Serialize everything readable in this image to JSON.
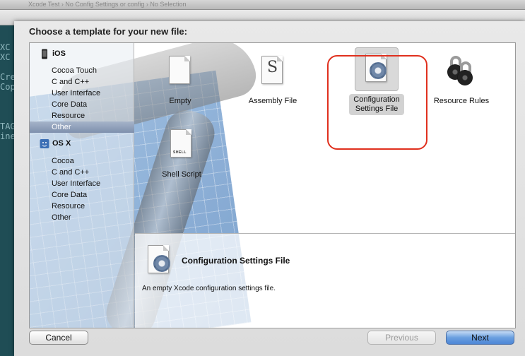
{
  "background": {
    "breadcrumb": "Xcode Test  ›  No Config Settings or config  ›  No Selection",
    "code_lines": [
      "XC",
      "XC",
      "",
      "Cre",
      "Cop",
      "",
      "",
      "",
      "TAG",
      "ine"
    ]
  },
  "dialog": {
    "title": "Choose a template for your new file:",
    "sidebar": {
      "groups": [
        {
          "label": "iOS",
          "items": [
            "Cocoa Touch",
            "C and C++",
            "User Interface",
            "Core Data",
            "Resource",
            "Other"
          ],
          "selected": "Other"
        },
        {
          "label": "OS X",
          "items": [
            "Cocoa",
            "C and C++",
            "User Interface",
            "Core Data",
            "Resource",
            "Other"
          ]
        }
      ]
    },
    "templates": [
      {
        "label_line1": "Empty",
        "label_line2": ""
      },
      {
        "label_line1": "Assembly File",
        "label_line2": "",
        "icon_letter": "S"
      },
      {
        "label_line1": "Configuration",
        "label_line2": "Settings File",
        "selected": true
      },
      {
        "label_line1": "Resource Rules",
        "label_line2": ""
      },
      {
        "label_line1": "Shell Script",
        "label_line2": "",
        "icon_tag": "SHELL"
      }
    ],
    "description": {
      "title": "Configuration Settings File",
      "text": "An empty Xcode configuration settings file."
    },
    "buttons": {
      "cancel": "Cancel",
      "previous": "Previous",
      "next": "Next"
    },
    "colors": {
      "highlight": "#e0301e",
      "selection": "#7e90ad",
      "primary_button": "#4d86d6"
    }
  }
}
